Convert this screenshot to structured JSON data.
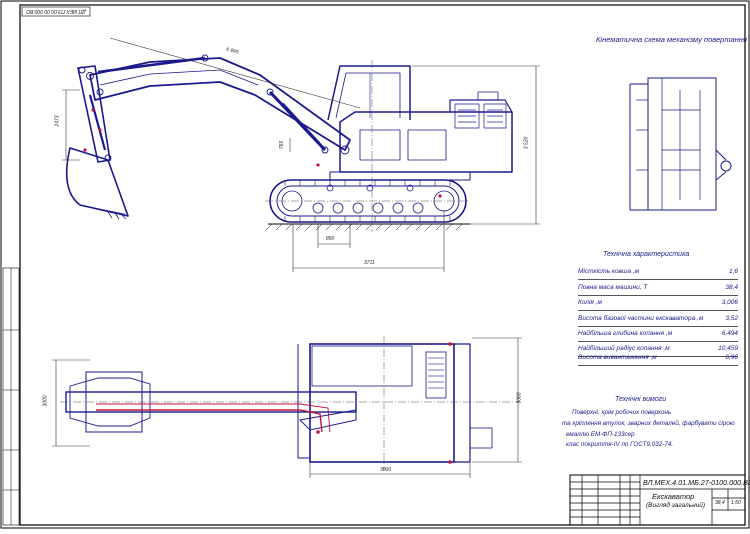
{
  "stamp_top": "ДП.МЕХ.ПЗ.00.00.000.ВО",
  "kinematic_title": "Кінематична схема механізму повертання",
  "spec_title": "Технічна характеристика",
  "specs": [
    {
      "label": "Місткість ковша ,м",
      "value": "1,6"
    },
    {
      "label": "Повна маса машини, Т",
      "value": "38,4"
    },
    {
      "label": "Колія ,м",
      "value": "3,006"
    },
    {
      "label": "Висота базової частини екскаватора ,м",
      "value": "3,52"
    },
    {
      "label": "Найбільша глибина копання ,м",
      "value": "6,494"
    },
    {
      "label": "Найбільший радіус копання ,м",
      "value": "10,459"
    },
    {
      "label": "Висота вивантаження ,м",
      "value": "6,96"
    }
  ],
  "tech_title": "Технічні вимоги",
  "tech_lines": [
    "Поверхні, крім робочих поверхонь",
    "та кріплення втулок, зварних деталей, фарбувати сірою",
    "емаллю ЕМ-ФП-133сер",
    "клас покриття-IV по ГОСТ9.032-74."
  ],
  "dims": {
    "boom_length": "6 995",
    "arm_height": "2473",
    "cab_height": "3 520",
    "track_h": "765",
    "track_w": "850",
    "track_len": "3711",
    "plan_width": "3000",
    "plan_len": "3000",
    "plan_width2": "3060"
  },
  "title_block": {
    "code": "ВЛ.МЕХ.4.01.МБ.27-0100.000.ВЗ",
    "name1": "Екскаватор",
    "name2": "(Вигляд загальний)",
    "scale": "1:50",
    "mass": "38,4"
  }
}
